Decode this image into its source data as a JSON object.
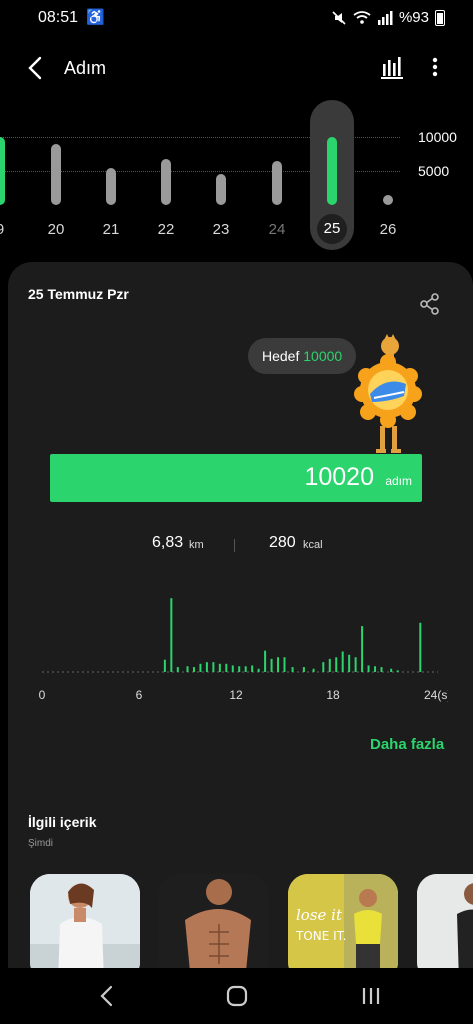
{
  "status_bar": {
    "time": "08:51",
    "battery": "%93"
  },
  "app_bar": {
    "title": "Adım"
  },
  "day_strip": {
    "goal_labels": [
      "10000",
      "5000"
    ],
    "days": [
      {
        "label": "9",
        "steps": 10000,
        "state": "goal"
      },
      {
        "label": "20",
        "steps": 9000,
        "state": "normal"
      },
      {
        "label": "21",
        "steps": 5500,
        "state": "normal"
      },
      {
        "label": "22",
        "steps": 6700,
        "state": "normal"
      },
      {
        "label": "23",
        "steps": 4500,
        "state": "normal"
      },
      {
        "label": "24",
        "steps": 6500,
        "state": "normal"
      },
      {
        "label": "25",
        "steps": 10020,
        "state": "selected"
      },
      {
        "label": "26",
        "steps": 0,
        "state": "future"
      }
    ]
  },
  "summary": {
    "date": "25 Temmuz Pzr",
    "goal_prefix": "Hedef",
    "goal_value": "10000",
    "steps": "10020",
    "steps_unit": "adım",
    "progress": 1.0,
    "distance": "6,83",
    "distance_unit": "km",
    "calories": "280",
    "calories_unit": "kcal"
  },
  "chart_data": {
    "type": "bar",
    "x_ticks": [
      "0",
      "6",
      "12",
      "18",
      "24(s)"
    ],
    "xlim": [
      0,
      24
    ],
    "ylim": [
      0,
      1000
    ],
    "values": [
      [
        7.6,
        150
      ],
      [
        8.0,
        900
      ],
      [
        8.4,
        60
      ],
      [
        9.0,
        70
      ],
      [
        9.4,
        60
      ],
      [
        9.8,
        100
      ],
      [
        10.2,
        120
      ],
      [
        10.6,
        120
      ],
      [
        11.0,
        100
      ],
      [
        11.4,
        100
      ],
      [
        11.8,
        80
      ],
      [
        12.2,
        70
      ],
      [
        12.6,
        70
      ],
      [
        13.0,
        80
      ],
      [
        13.4,
        40
      ],
      [
        13.8,
        260
      ],
      [
        14.2,
        160
      ],
      [
        14.6,
        180
      ],
      [
        15.0,
        180
      ],
      [
        15.5,
        60
      ],
      [
        16.2,
        60
      ],
      [
        16.8,
        40
      ],
      [
        17.4,
        120
      ],
      [
        17.8,
        160
      ],
      [
        18.2,
        180
      ],
      [
        18.6,
        250
      ],
      [
        19.0,
        210
      ],
      [
        19.4,
        180
      ],
      [
        19.8,
        560
      ],
      [
        20.2,
        80
      ],
      [
        20.6,
        70
      ],
      [
        21.0,
        60
      ],
      [
        21.6,
        40
      ],
      [
        22.0,
        20
      ],
      [
        23.4,
        600
      ]
    ]
  },
  "more_link": "Daha fazla",
  "related": {
    "title": "İlgili içerik",
    "subtitle": "Şimdi"
  }
}
